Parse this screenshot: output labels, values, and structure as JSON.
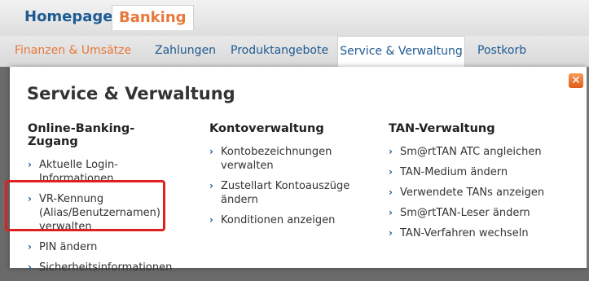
{
  "topnav": {
    "items": [
      {
        "label": "Homepage"
      },
      {
        "label": "Banking"
      }
    ]
  },
  "subnav": {
    "items": [
      {
        "label": "Finanzen & Umsätze"
      },
      {
        "label": "Zahlungen"
      },
      {
        "label": "Produktangebote"
      },
      {
        "label": "Service & Verwaltung"
      },
      {
        "label": "Postkorb"
      }
    ]
  },
  "panel": {
    "title": "Service & Verwaltung",
    "close_label": "✕",
    "columns": [
      {
        "heading": "Online-Banking-Zugang",
        "items": [
          {
            "label": "Aktuelle Login-Informationen"
          },
          {
            "label": "VR-Kennung (Alias/Benutzernamen) verwalten"
          },
          {
            "label": "PIN ändern"
          },
          {
            "label": "Sicherheitsinformationen"
          }
        ]
      },
      {
        "heading": "Kontoverwaltung",
        "items": [
          {
            "label": "Kontobezeichnungen verwalten"
          },
          {
            "label": "Zustellart Kontoauszüge ändern"
          },
          {
            "label": "Konditionen anzeigen"
          }
        ]
      },
      {
        "heading": "TAN-Verwaltung",
        "items": [
          {
            "label": "Sm@rtTAN ATC angleichen"
          },
          {
            "label": "TAN-Medium ändern"
          },
          {
            "label": "Verwendete TANs anzeigen"
          },
          {
            "label": "Sm@rtTAN-Leser ändern"
          },
          {
            "label": "TAN-Verfahren wechseln"
          }
        ]
      }
    ]
  }
}
